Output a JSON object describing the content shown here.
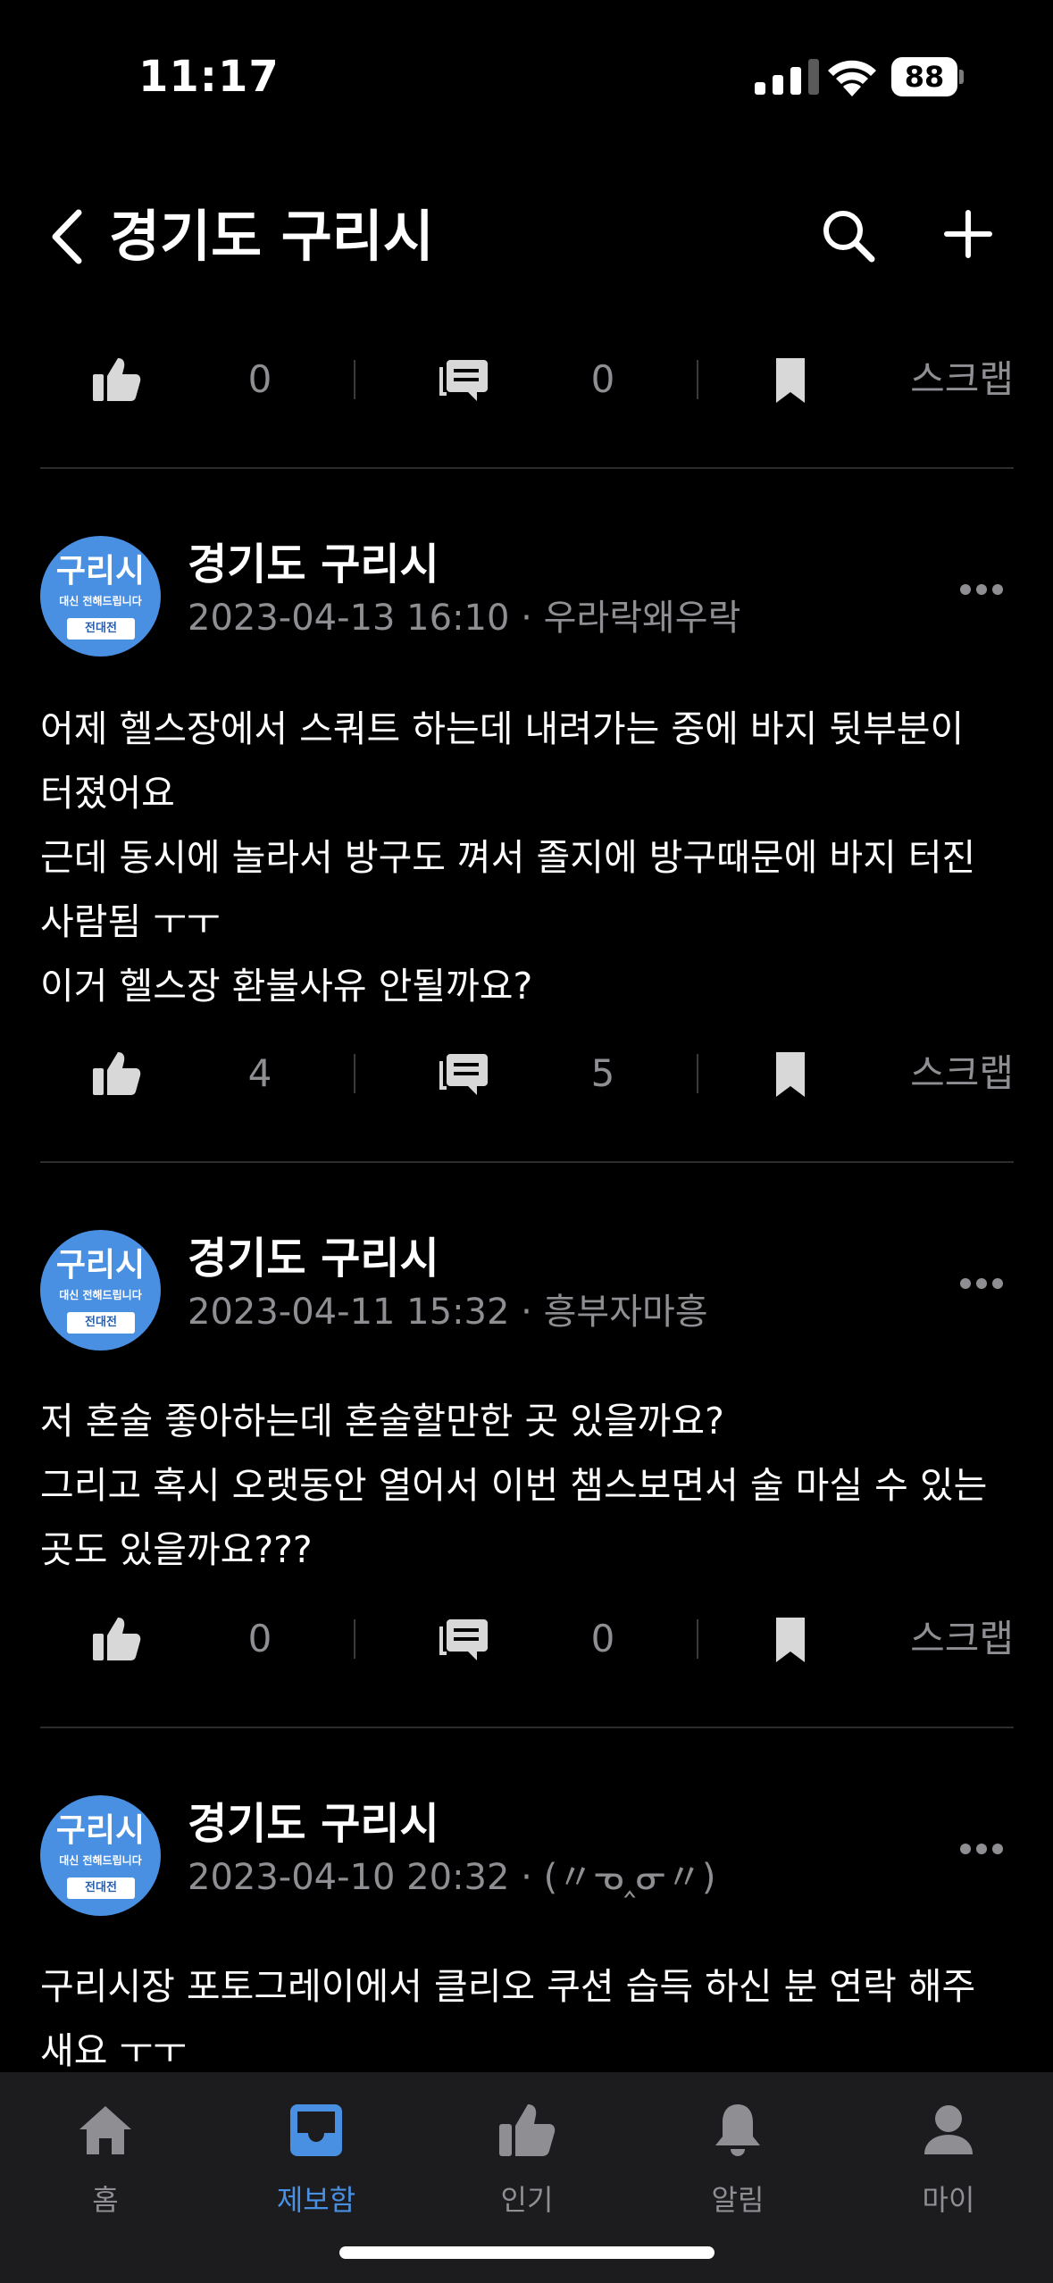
{
  "status_bar": {
    "time": "11:17",
    "battery": "88"
  },
  "header": {
    "title": "경기도 구리시"
  },
  "top_actions": {
    "likes": "0",
    "comments": "0",
    "scrap": "스크랩"
  },
  "posts": [
    {
      "author": "경기도 구리시",
      "meta": "2023-04-13 16:10 · 우라락왜우락",
      "body": "어제 헬스장에서 스쿼트 하는데 내려가는 중에 바지 뒷부분이\n터졌어요\n근데 동시에 놀라서 방구도 껴서 졸지에 방구때문에 바지 터진\n사람됨 ㅜㅜ\n이거 헬스장 환불사유 안될까요?",
      "likes": "4",
      "comments": "5",
      "scrap": "스크랩"
    },
    {
      "author": "경기도 구리시",
      "meta": "2023-04-11 15:32 · 흥부자마흥",
      "body": "저 혼술 좋아하는데 혼술할만한 곳 있을까요?\n그리고 혹시 오랫동안 열어서 이번 챔스보면서 술 마실 수 있는\n곳도 있을까요???",
      "likes": "0",
      "comments": "0",
      "scrap": "스크랩"
    },
    {
      "author": "경기도 구리시",
      "meta": "2023-04-10 20:32 · (〃ᓀ‸ᓂ〃)",
      "body": "구리시장 포토그레이에서 클리오 쿠션 습득 하신 분 연락 해주\n새요 ㅜㅜ"
    }
  ],
  "avatar": {
    "main": "구리시",
    "sub": "대신 전해드립니다",
    "badge": "전대전"
  },
  "tabs": [
    {
      "label": "홈",
      "icon": "home-icon"
    },
    {
      "label": "제보함",
      "icon": "inbox-icon",
      "active": true
    },
    {
      "label": "인기",
      "icon": "thumbs-up-icon"
    },
    {
      "label": "알림",
      "icon": "bell-icon"
    },
    {
      "label": "마이",
      "icon": "person-icon"
    }
  ],
  "colors": {
    "accent": "#4a90e2",
    "muted": "#8e8e93",
    "background": "#000000",
    "tab_bar": "#1c1c1e"
  }
}
